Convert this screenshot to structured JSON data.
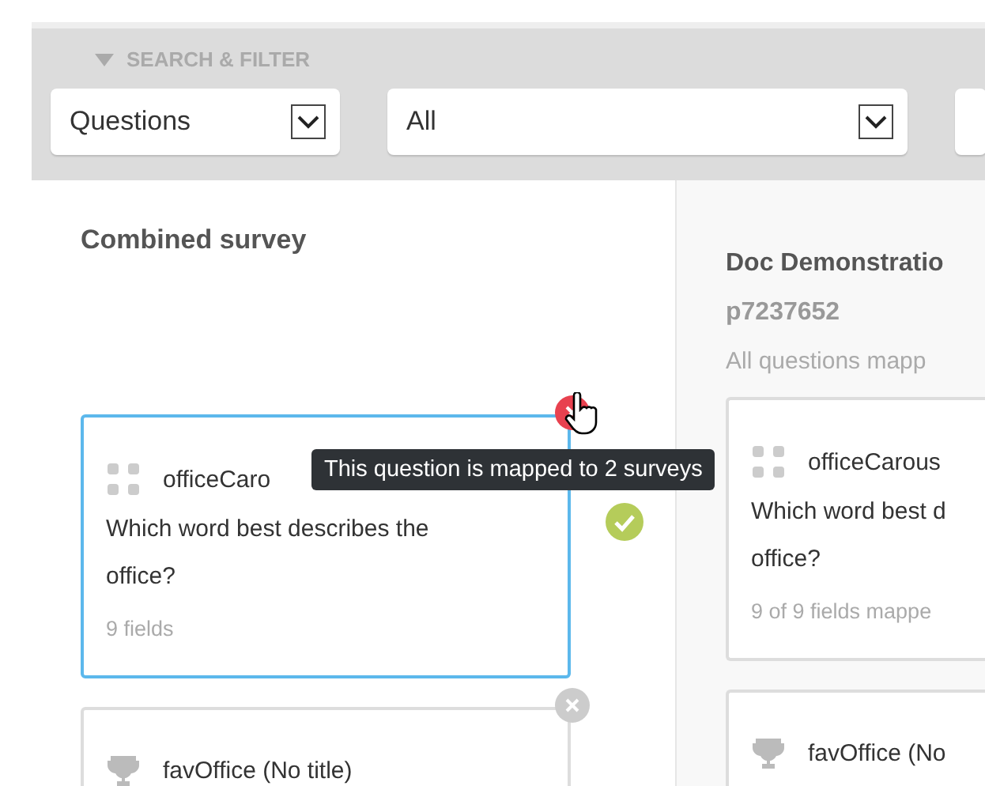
{
  "filter": {
    "title": "SEARCH & FILTER",
    "expanded": true,
    "dropdowns": [
      {
        "value": "Questions"
      },
      {
        "value": "All"
      },
      {
        "cut": true
      }
    ]
  },
  "combined": {
    "title": "Combined survey",
    "cards": [
      {
        "kind": "grid",
        "title": "officeCaro",
        "question": "Which word best describes the office?",
        "footer": "9 fields",
        "selected": true,
        "mapped": true
      },
      {
        "kind": "trophy",
        "title": "favOffice (No title)",
        "selected": false
      }
    ]
  },
  "tooltip": "This question is mapped to 2 surveys",
  "source": {
    "title": "Doc Demonstratio",
    "id": "p7237652",
    "note": "All questions mapp",
    "cards": [
      {
        "kind": "grid",
        "title": "officeCarous",
        "question_lines": [
          "Which word best d",
          "office?"
        ],
        "footer": "9 of 9 fields mappe"
      },
      {
        "kind": "trophy",
        "title": "favOffice (No"
      }
    ]
  }
}
